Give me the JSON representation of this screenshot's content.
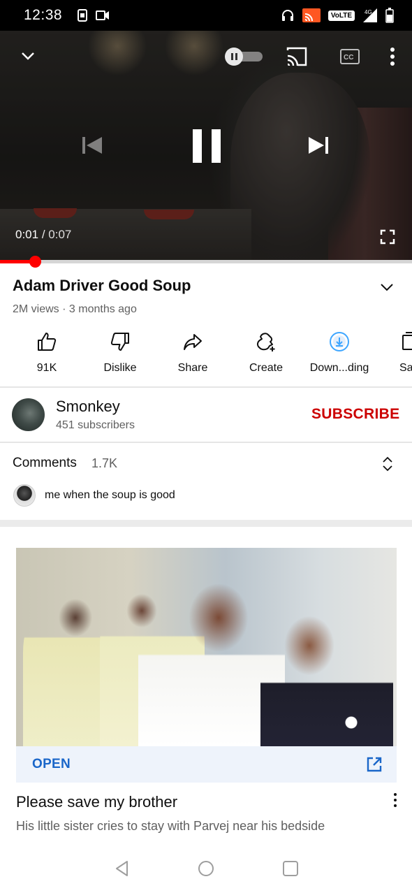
{
  "status_bar": {
    "time": "12:38",
    "network_badge": "VoLTE",
    "left_icons": [
      "sim-card-icon",
      "video-record-icon"
    ],
    "right_icons": [
      "headphones-icon",
      "cast-active-icon",
      "volte-icon",
      "signal-4g-icon",
      "battery-icon"
    ]
  },
  "player": {
    "current_time": "0:01",
    "separator": "/",
    "duration": "0:07",
    "progress_fraction": 0.085,
    "autoplay": "on",
    "accent_color": "#ff0000"
  },
  "video": {
    "title": "Adam Driver Good Soup",
    "meta": "2M views · 3 months ago"
  },
  "actions": [
    {
      "label": "91K",
      "icon": "thumbs-up-icon"
    },
    {
      "label": "Dislike",
      "icon": "thumbs-down-icon"
    },
    {
      "label": "Share",
      "icon": "share-arrow-icon"
    },
    {
      "label": "Create",
      "icon": "create-sparkle-icon"
    },
    {
      "label": "Down...ding",
      "icon": "downloading-icon"
    },
    {
      "label": "Sa",
      "icon": "save-playlist-icon"
    }
  ],
  "channel": {
    "name": "Smonkey",
    "subscribers": "451 subscribers",
    "subscribe_label": "SUBSCRIBE",
    "subscribe_color": "#cc0000"
  },
  "comments": {
    "label": "Comments",
    "count": "1.7K",
    "top_comment": "me when the soup is good"
  },
  "ad": {
    "open_label": "OPEN",
    "title": "Please save my brother",
    "description": "His little sister cries to stay with Parvej near his bedside",
    "accent_color": "#1a66c9"
  },
  "nav": {
    "buttons": [
      "back-icon",
      "home-icon",
      "recents-icon"
    ]
  }
}
